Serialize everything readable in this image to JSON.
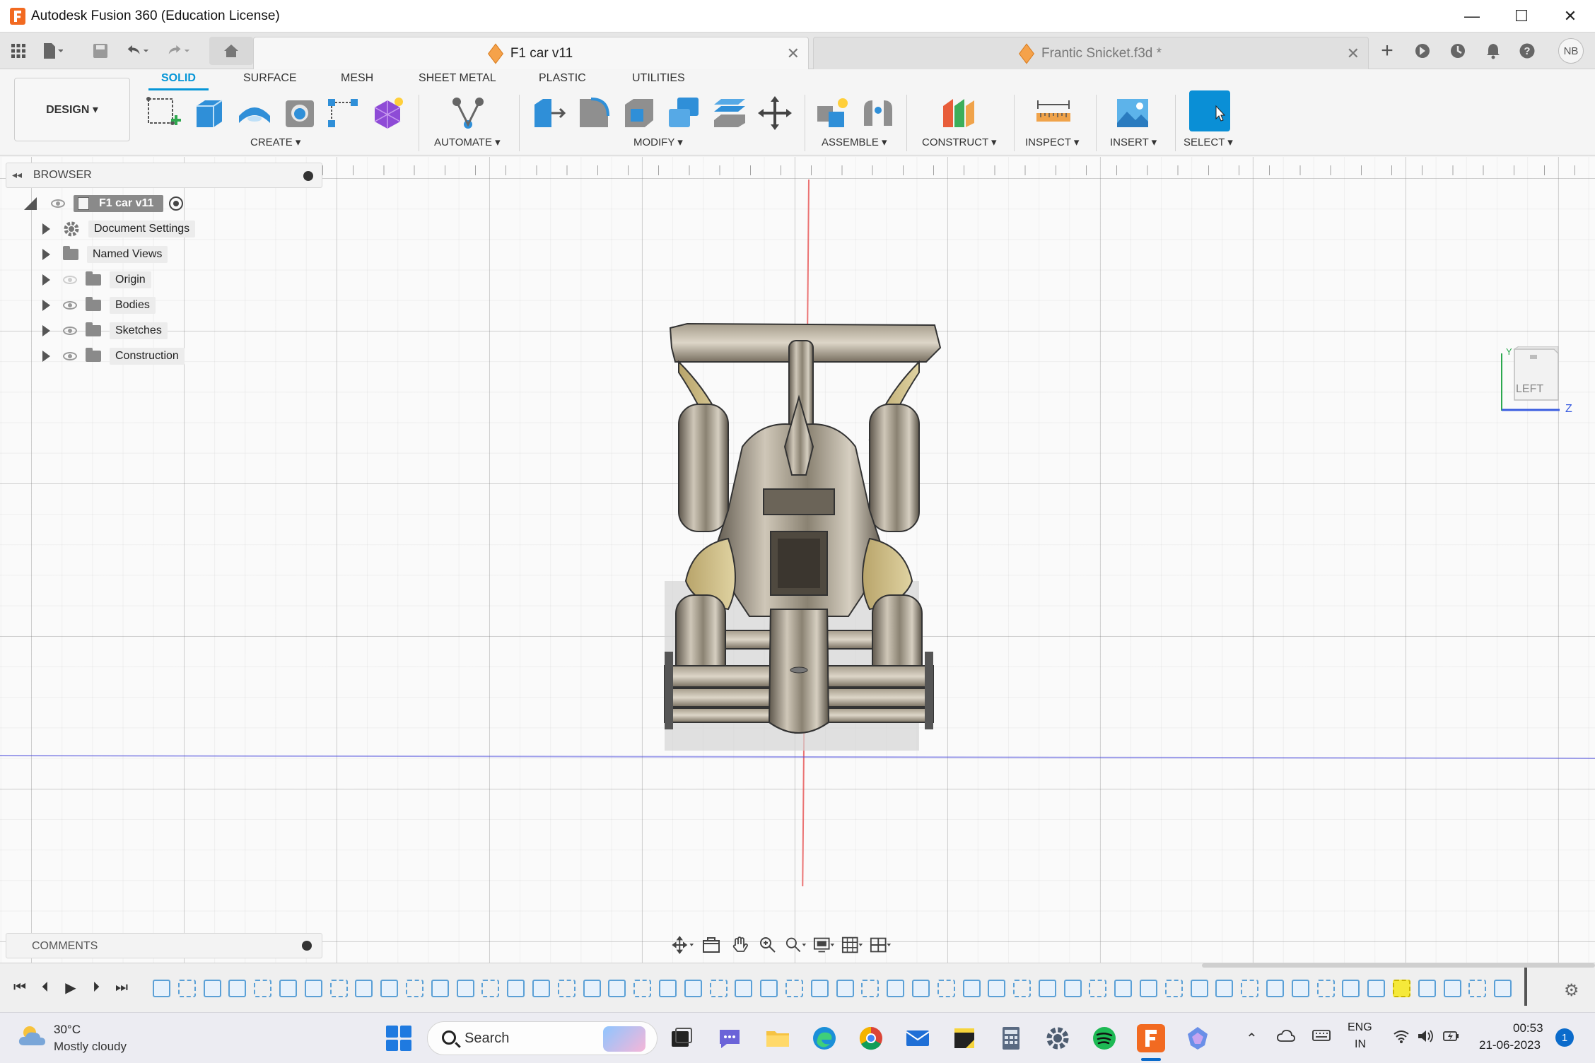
{
  "window": {
    "title": "Autodesk Fusion 360 (Education License)",
    "minimize": "—",
    "maximize": "☐",
    "close": "✕"
  },
  "tabs": [
    {
      "label": "F1 car v11",
      "active": true,
      "close": "✕"
    },
    {
      "label": "Frantic Snicket.f3d *",
      "active": false,
      "close": "✕"
    }
  ],
  "user_initials": "NB",
  "workspace": {
    "label": "DESIGN ▾"
  },
  "ribbon_tabs": [
    "SOLID",
    "SURFACE",
    "MESH",
    "SHEET METAL",
    "PLASTIC",
    "UTILITIES"
  ],
  "ribbon_groups": [
    "CREATE ▾",
    "AUTOMATE ▾",
    "MODIFY ▾",
    "ASSEMBLE ▾",
    "CONSTRUCT ▾",
    "INSPECT ▾",
    "INSERT ▾",
    "SELECT ▾"
  ],
  "browser": {
    "title": "BROWSER",
    "root": "F1 car v11",
    "items": [
      "Document Settings",
      "Named Views",
      "Origin",
      "Bodies",
      "Sketches",
      "Construction"
    ]
  },
  "comments": {
    "title": "COMMENTS"
  },
  "viewcube": {
    "face": "LEFT",
    "axis_y": "Y",
    "axis_z": "Z"
  },
  "colors": {
    "accent": "#0696d7",
    "orange": "#f26a21",
    "highlight": "#f5e93a"
  },
  "taskbar": {
    "weather_temp": "30°C",
    "weather_desc": "Mostly cloudy",
    "search": "Search",
    "lang1": "ENG",
    "lang2": "IN",
    "time": "00:53",
    "date": "21-06-2023",
    "notifications": "1"
  }
}
